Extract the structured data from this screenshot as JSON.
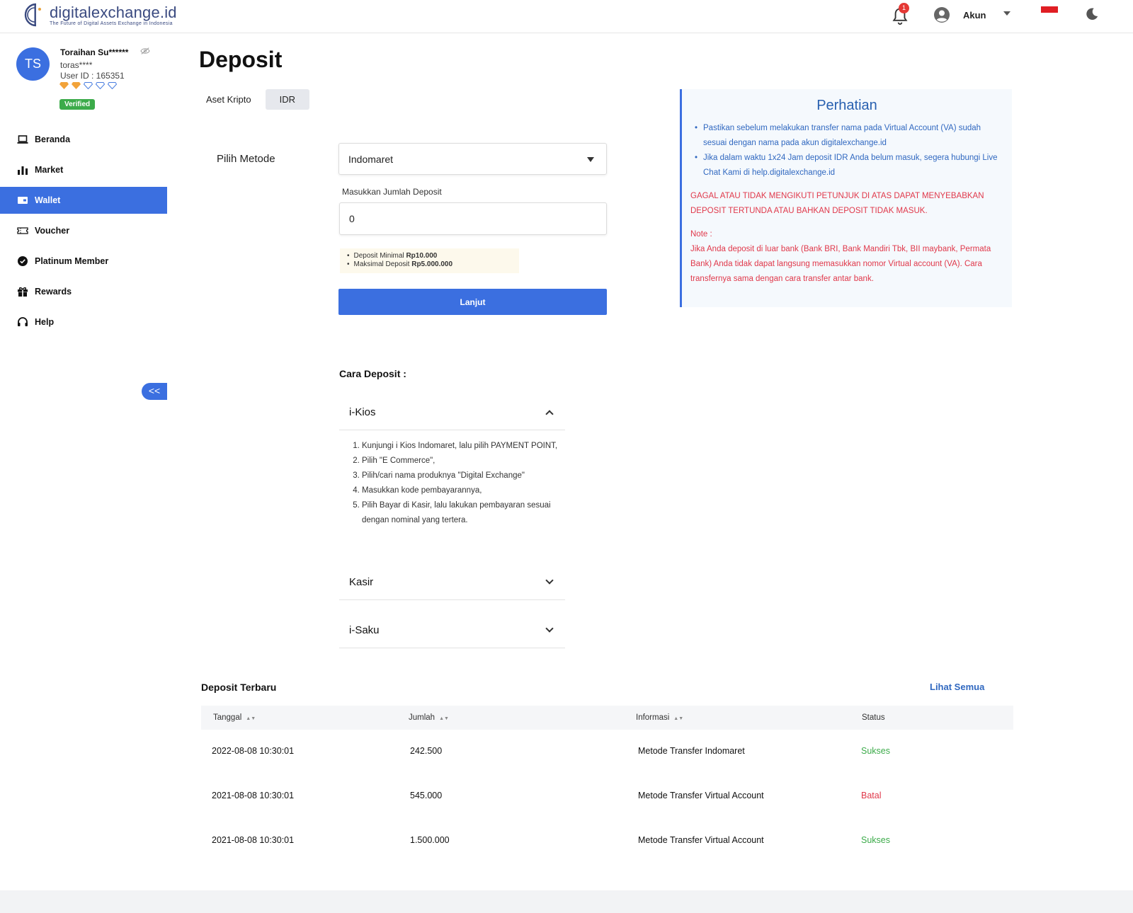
{
  "brand": {
    "name": "digitalexchange.id",
    "tagline": "The Future of Digital Assets Exchange in Indonesia"
  },
  "header": {
    "notification_count": "1",
    "account_label": "Akun"
  },
  "user": {
    "initials": "TS",
    "name": "Toraihan Su******",
    "handle": "toras****",
    "user_id": "User ID : 165351",
    "verified": "Verified"
  },
  "sidebar": {
    "items": [
      {
        "label": "Beranda",
        "icon": "laptop-icon"
      },
      {
        "label": "Market",
        "icon": "bar-chart-icon"
      },
      {
        "label": "Wallet",
        "icon": "wallet-icon"
      },
      {
        "label": "Voucher",
        "icon": "ticket-icon"
      },
      {
        "label": "Platinum Member",
        "icon": "badge-check-icon"
      },
      {
        "label": "Rewards",
        "icon": "gift-icon"
      },
      {
        "label": "Help",
        "icon": "headset-icon"
      }
    ],
    "active": "Wallet",
    "collapse_label": "<<"
  },
  "page": {
    "title": "Deposit",
    "tabs": [
      {
        "label": "Aset Kripto",
        "active": false
      },
      {
        "label": "IDR",
        "active": true
      }
    ]
  },
  "form": {
    "method_label": "Pilih Metode",
    "method_value": "Indomaret",
    "amount_label": "Masukkan Jumlah Deposit",
    "amount_value": "0",
    "min_prefix": "Deposit Minimal",
    "min_value": "Rp10.000",
    "max_prefix": "Maksimal Deposit",
    "max_value": "Rp5.000.000",
    "submit_label": "Lanjut"
  },
  "notice": {
    "title": "Perhatian",
    "bullets": [
      "Pastikan sebelum melakukan transfer nama pada Virtual Account (VA) sudah sesuai dengan nama pada akun digitalexchange.id",
      "Jika dalam waktu 1x24 Jam deposit IDR Anda belum masuk, segera hubungi Live Chat Kami di help.digitalexchange.id"
    ],
    "warning": "GAGAL ATAU TIDAK MENGIKUTI PETUNJUK DI ATAS DAPAT MENYEBABKAN DEPOSIT TERTUNDA ATAU BAHKAN DEPOSIT TIDAK MASUK.",
    "note_heading": "Note :",
    "note_body": "Jika Anda deposit di luar bank (Bank BRI, Bank Mandiri Tbk, BII maybank, Permata Bank) Anda tidak dapat langsung memasukkan nomor Virtual account (VA). Cara transfernya sama dengan cara transfer antar bank."
  },
  "guide": {
    "title": "Cara Deposit :",
    "sections": [
      {
        "label": "i-Kios",
        "expanded": true
      },
      {
        "label": "Kasir",
        "expanded": false
      },
      {
        "label": "i-Saku",
        "expanded": false
      }
    ],
    "steps": [
      "Kunjungi i Kios Indomaret, lalu pilih PAYMENT POINT,",
      "Pilih \"E Commerce\",",
      "Pilih/cari nama produknya \"Digital Exchange\"",
      "Masukkan kode pembayarannya,",
      "Pilih Bayar di Kasir, lalu lakukan pembayaran sesuai dengan nominal yang tertera."
    ]
  },
  "recent": {
    "title": "Deposit Terbaru",
    "see_all": "Lihat Semua",
    "columns": [
      "Tanggal",
      "Jumlah",
      "Informasi",
      "Status"
    ],
    "rows": [
      {
        "date": "2022-08-08 10:30:01",
        "amount": "242.500",
        "info": "Metode Transfer Indomaret",
        "status": "Sukses"
      },
      {
        "date": "2021-08-08 10:30:01",
        "amount": "545.000",
        "info": "Metode Transfer Virtual Account",
        "status": "Batal"
      },
      {
        "date": "2021-08-08 10:30:01",
        "amount": "1.500.000",
        "info": "Metode Transfer Virtual Account",
        "status": "Sukses"
      }
    ]
  },
  "colors": {
    "accent": "#3b6fe0",
    "success": "#3cab4a",
    "danger": "#e0384a",
    "notice_text": "#3068c0"
  }
}
